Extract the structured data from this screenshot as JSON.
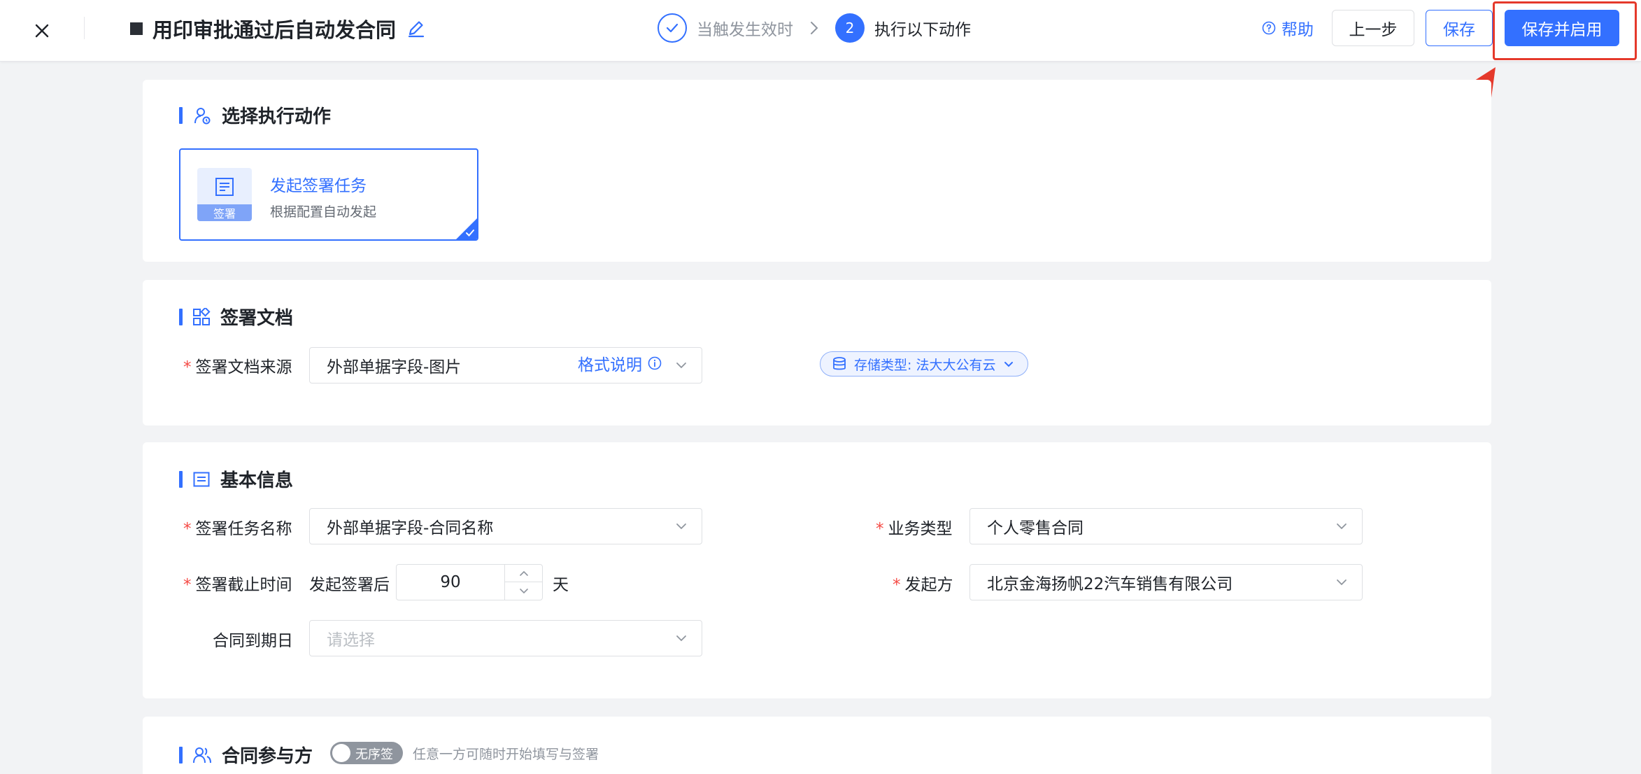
{
  "header": {
    "title": "用印审批通过后自动发合同",
    "steps": [
      {
        "label": "当触发生效时",
        "state": "done"
      },
      {
        "number": "2",
        "label": "执行以下动作",
        "state": "active"
      }
    ],
    "help_label": "帮助",
    "prev_label": "上一步",
    "save_label": "保存",
    "save_enable_label": "保存并启用"
  },
  "accent_color": "#3370ff",
  "highlight_color": "#e5392b",
  "action_section": {
    "title": "选择执行动作",
    "option": {
      "name": "发起签署任务",
      "description": "根据配置自动发起",
      "icon_caption": "签署",
      "selected": true
    }
  },
  "document_section": {
    "title": "签署文档",
    "source_label": "签署文档来源",
    "source_value": "外部单据字段-图片",
    "format_link": "格式说明",
    "storage_tag": "存储类型: 法大大公有云"
  },
  "basic_section": {
    "title": "基本信息",
    "task_name_label": "签署任务名称",
    "task_name_value": "外部单据字段-合同名称",
    "biz_type_label": "业务类型",
    "biz_type_value": "个人零售合同",
    "deadline_label": "签署截止时间",
    "deadline_prefix": "发起签署后",
    "deadline_value": "90",
    "deadline_unit": "天",
    "initiator_label": "发起方",
    "initiator_value": "北京金海扬帆22汽车销售有限公司",
    "expiry_label": "合同到期日",
    "expiry_placeholder": "请选择"
  },
  "participants_section": {
    "title": "合同参与方",
    "toggle_label": "无序签",
    "toggle_on": false,
    "hint": "任意一方可随时开始填写与签署"
  }
}
